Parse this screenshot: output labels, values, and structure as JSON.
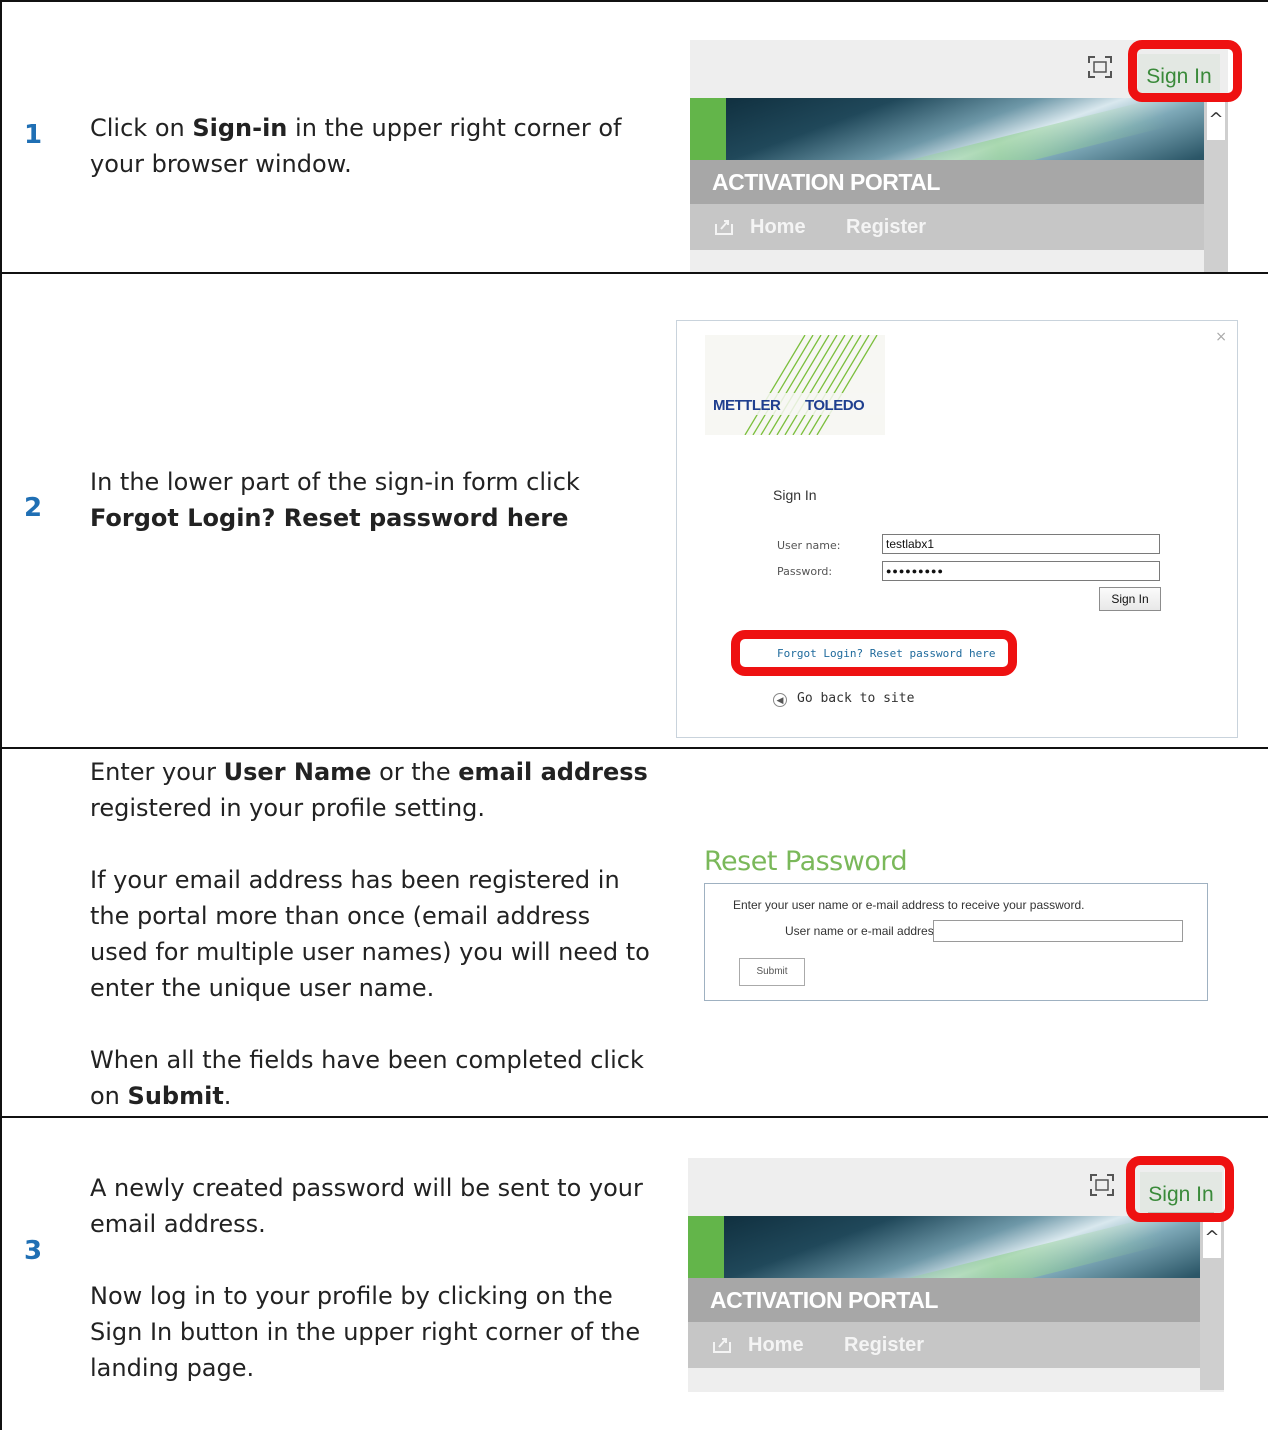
{
  "steps": [
    {
      "number": "1",
      "text_pre": "Click on ",
      "text_bold": "Sign-in",
      "text_post": " in the upper right corner of your browser window."
    },
    {
      "number": "2",
      "text_pre": "In the lower part of the sign-in form click ",
      "text_bold": "Forgot Login? Reset password here"
    },
    {
      "p1_pre": "Enter your ",
      "p1_bold1": "User Name",
      "p1_mid": " or the ",
      "p1_bold2": "email address",
      "p1_post": " registered in your profile setting.",
      "p2": "If your email address has been registered in the portal more than once (email address used for multiple user names) you will need to enter the unique user name.",
      "p3_pre": "When all the fields have been completed click on ",
      "p3_bold": "Submit",
      "p3_post": "."
    },
    {
      "number": "3",
      "p1": "A newly created password will be sent to your email address.",
      "p2": "Now log in to your profile by clicking on the Sign In button in the upper right corner of the landing page."
    }
  ],
  "portal": {
    "signin_label": "Sign In",
    "title": "ACTIVATION PORTAL",
    "nav_home": "Home",
    "nav_register": "Register",
    "icons": [
      "fullscreen-icon",
      "scroll-up-arrow-icon",
      "home-share-icon"
    ]
  },
  "signin_dialog": {
    "logo_left": "METTLER",
    "logo_right": "TOLEDO",
    "heading": "Sign In",
    "username_label": "User name:",
    "username_value": "testlabx1",
    "password_label": "Password:",
    "password_value": "●●●●●●●●●",
    "button_label": "Sign In",
    "forgot_link": "Forgot Login? Reset password here",
    "go_back": "Go back to site",
    "close": "×"
  },
  "reset_form": {
    "title": "Reset Password",
    "instruction": "Enter your user name or e-mail address to receive your password.",
    "field_label": "User name or e-mail address:",
    "submit_label": "Submit"
  },
  "colors": {
    "step_number": "#1f6fb4",
    "highlight": "#ee1111",
    "portal_green": "#63b54a",
    "reset_title": "#7ab85a"
  }
}
